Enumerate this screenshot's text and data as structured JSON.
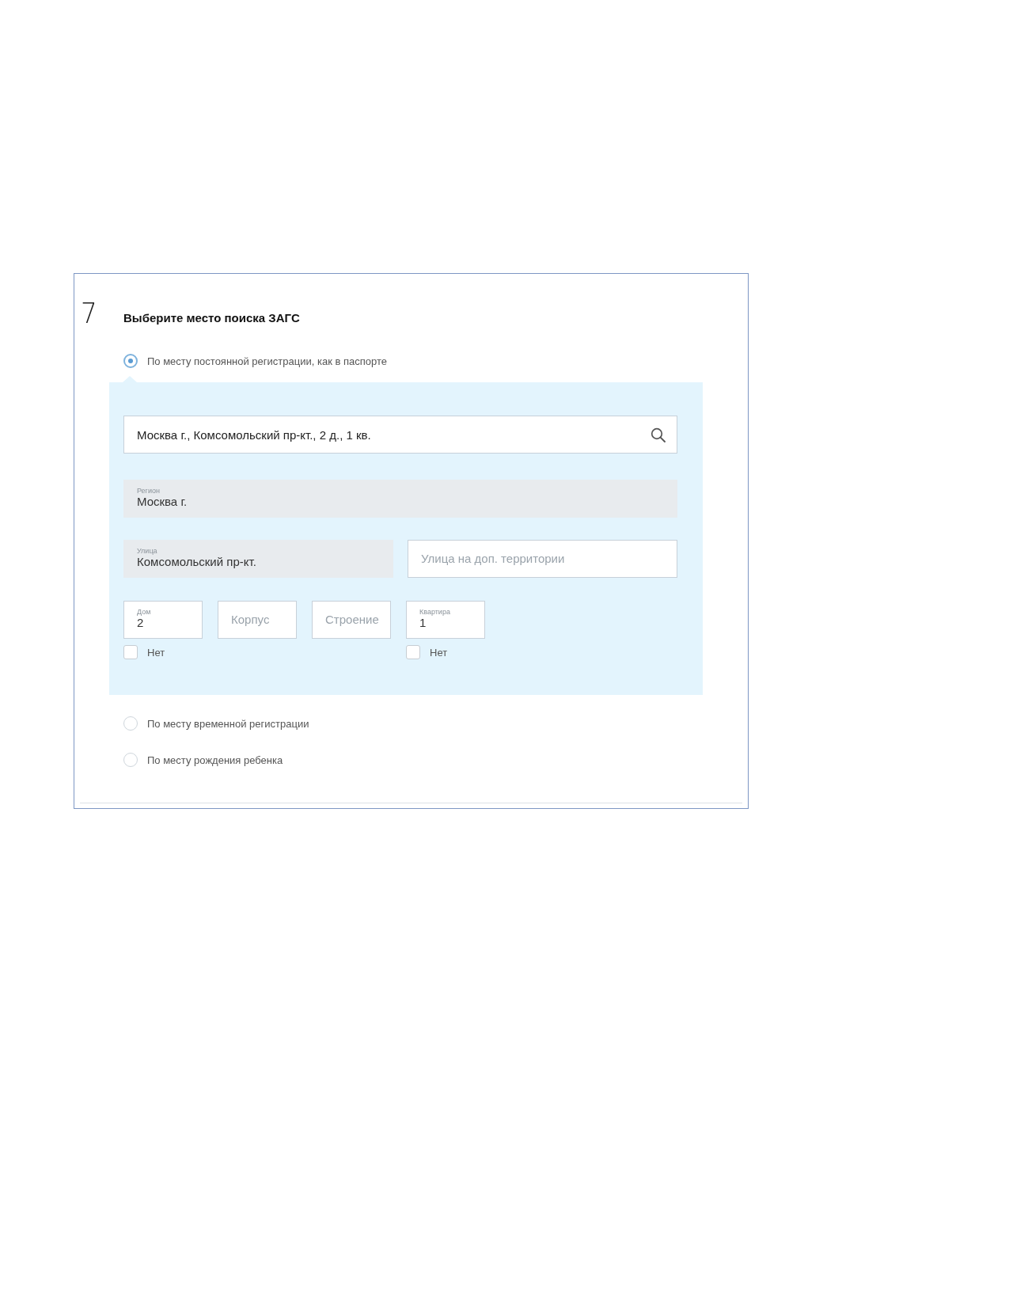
{
  "step": {
    "number": "7",
    "title": "Выберите место поиска ЗАГС"
  },
  "options": [
    {
      "label": "По месту постоянной регистрации, как в паспорте",
      "selected": true
    },
    {
      "label": "По месту временной регистрации",
      "selected": false
    },
    {
      "label": "По месту рождения ребенка",
      "selected": false
    }
  ],
  "address": {
    "search": {
      "value": "Москва г., Комсомольский пр-кт., 2 д., 1 кв."
    },
    "rows": [
      {
        "kind": "full",
        "fields": [
          {
            "label": "Регион",
            "value": "Москва г.",
            "disabled": true
          }
        ]
      },
      {
        "kind": "half",
        "fields": [
          {
            "label": "Улица",
            "value": "Комсомольский пр-кт.",
            "disabled": true
          },
          {
            "placeholder": "Улица на доп. территории",
            "disabled": false
          }
        ]
      },
      {
        "kind": "small",
        "fields": [
          {
            "label": "Дом",
            "value": "2",
            "disabled": false,
            "none_checkbox": {
              "label": "Нет",
              "checked": false
            }
          },
          {
            "placeholder": "Корпус",
            "disabled": false
          },
          {
            "placeholder": "Строение",
            "disabled": false
          },
          {
            "label": "Квартира",
            "value": "1",
            "disabled": false,
            "none_checkbox": {
              "label": "Нет",
              "checked": false
            }
          }
        ]
      }
    ]
  }
}
